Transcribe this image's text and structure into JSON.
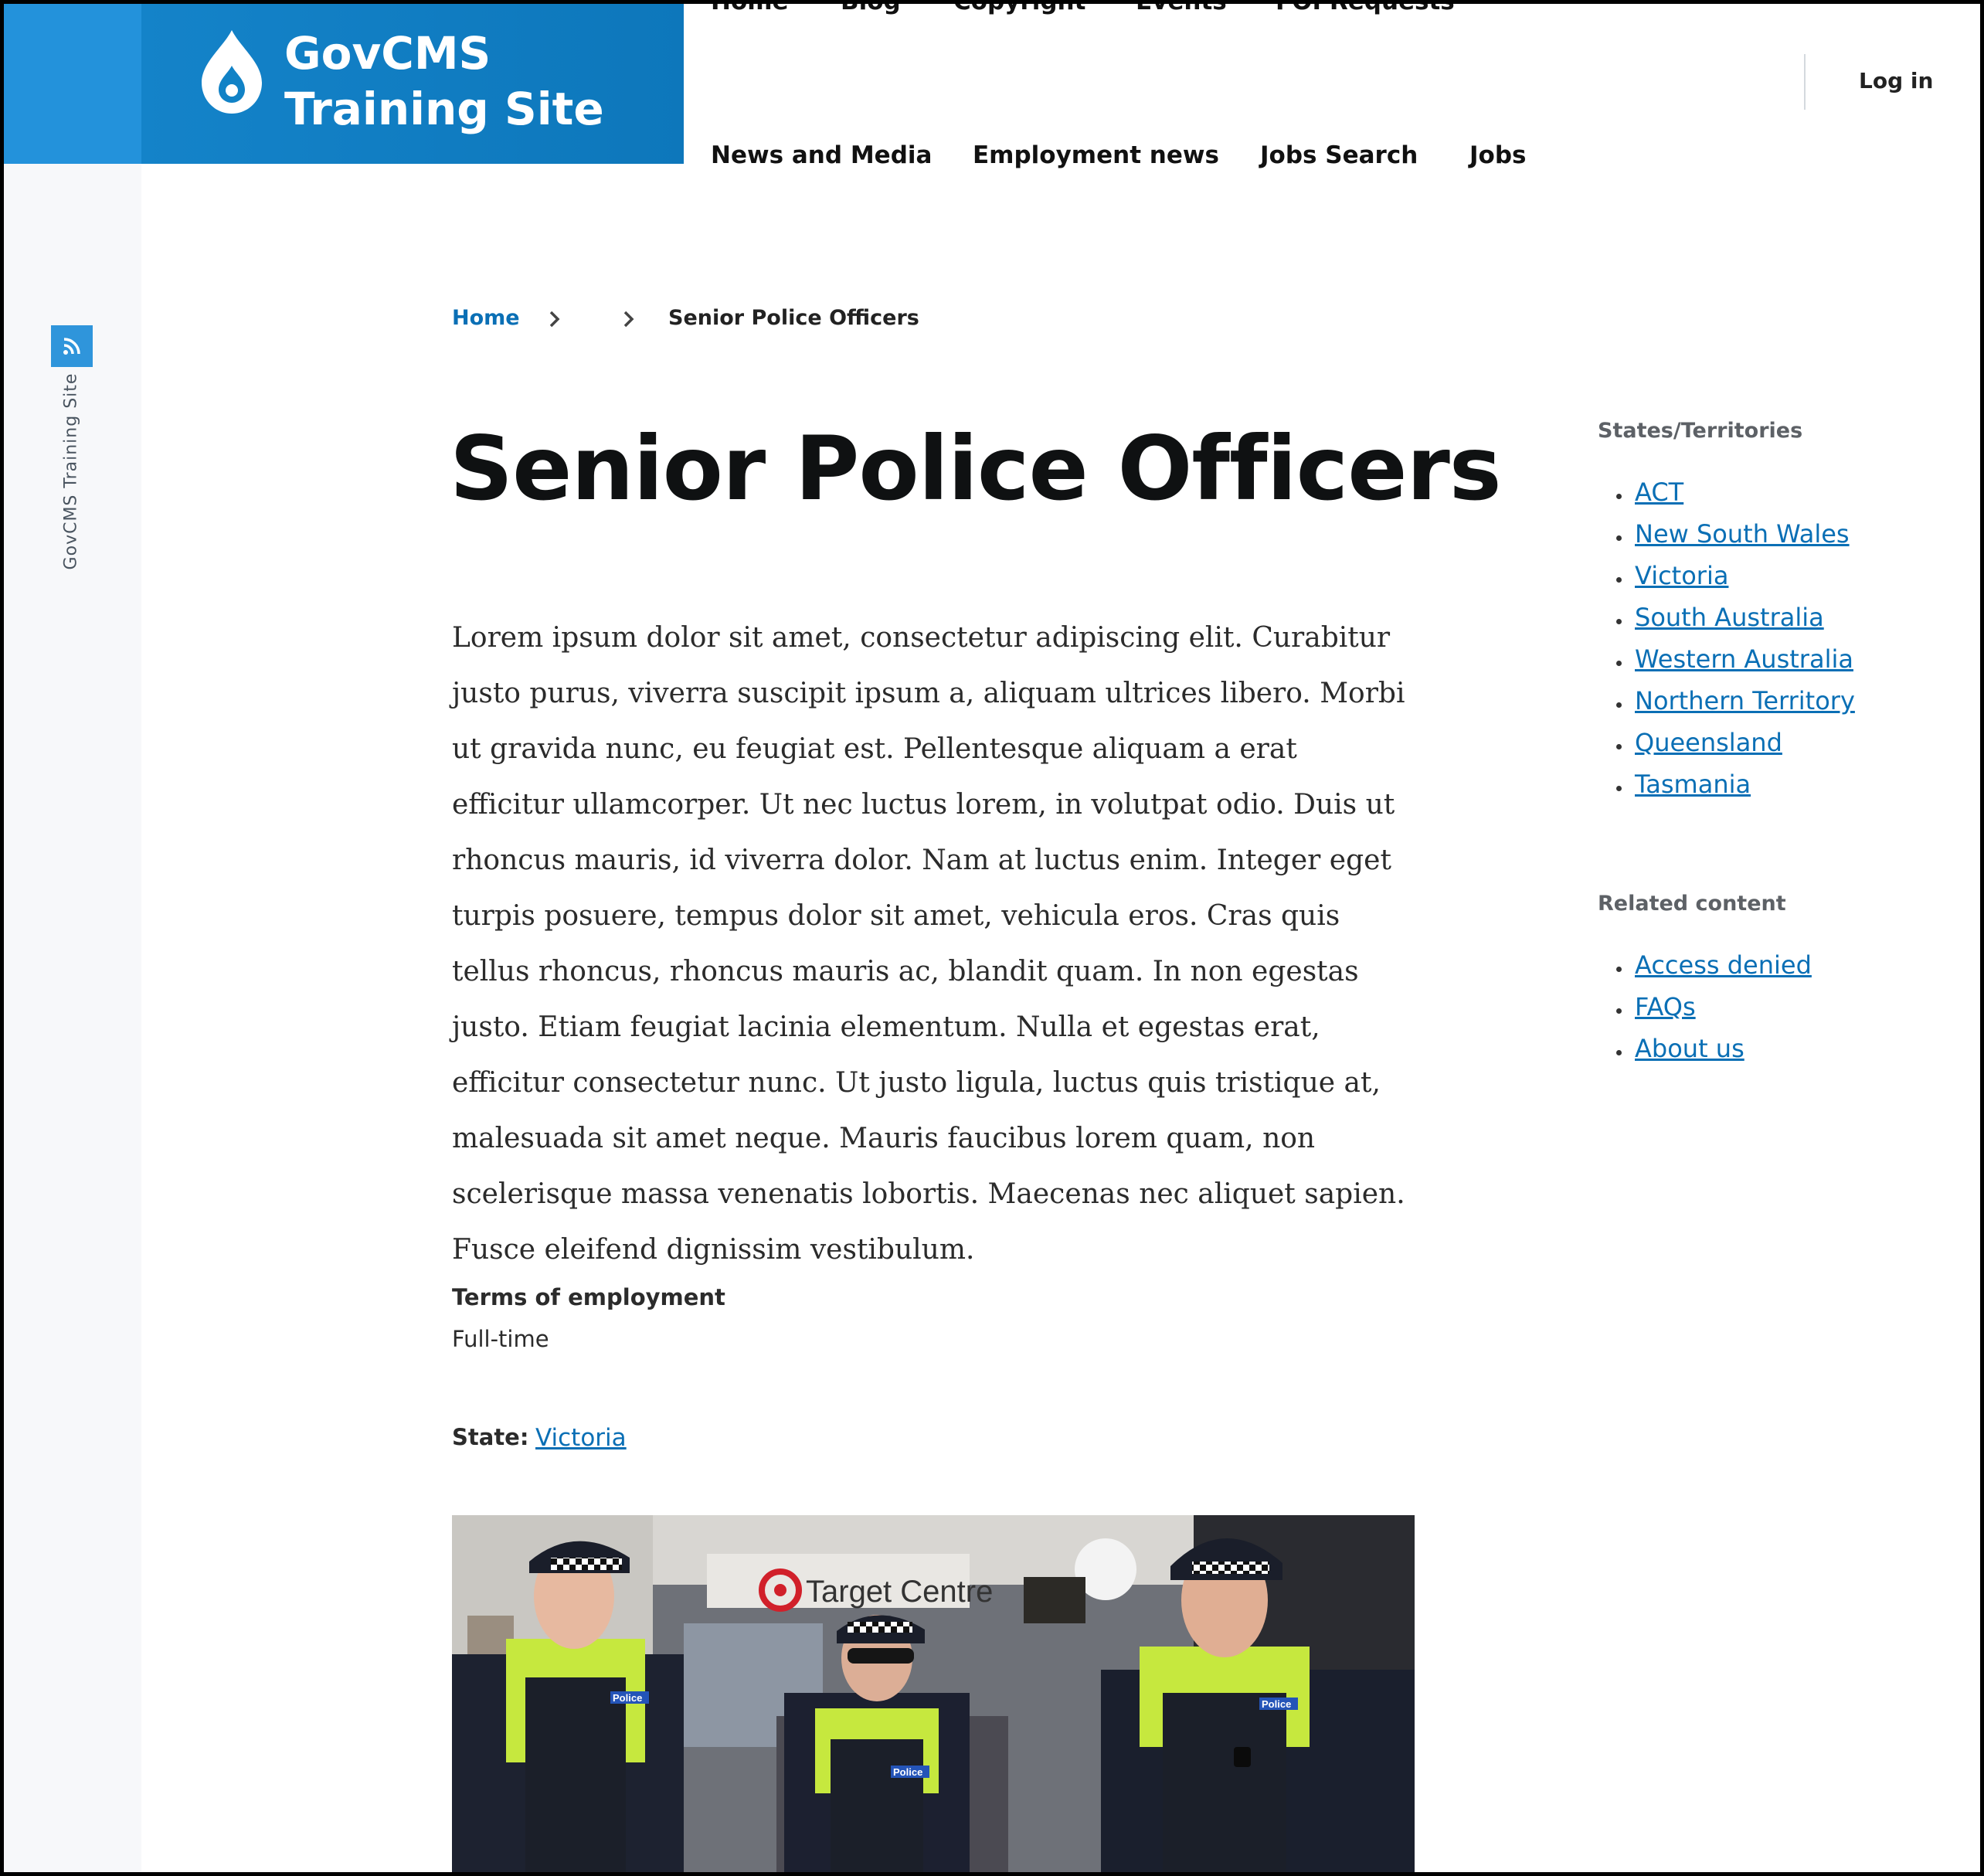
{
  "site": {
    "name_line1": "GovCMS",
    "name_line2": "Training Site",
    "rail_label": "GovCMS Training Site"
  },
  "nav": {
    "top": [
      "Home",
      "Blog",
      "Copyright",
      "Events",
      "FOI Requests"
    ],
    "bottom": [
      "News and Media",
      "Employment news",
      "Jobs Search",
      "Jobs"
    ],
    "login": "Log in"
  },
  "breadcrumb": {
    "home": "Home",
    "current": "Senior Police Officers"
  },
  "page": {
    "title": "Senior Police Officers",
    "body": "Lorem ipsum dolor sit amet, consectetur adipiscing elit. Curabitur justo purus, viverra suscipit ipsum a, aliquam ultrices libero. Morbi ut gravida nunc, eu feugiat est. Pellentesque aliquam a erat efficitur ullamcorper. Ut nec luctus lorem, in volutpat odio. Duis ut rhoncus mauris, id viverra dolor. Nam at luctus enim. Integer eget turpis posuere, tempus dolor sit amet, vehicula eros. Cras quis tellus rhoncus, rhoncus mauris ac, blandit quam. In non egestas justo. Etiam feugiat lacinia elementum. Nulla et egestas erat, efficitur consectetur nunc. Ut justo ligula, luctus quis tristique at, malesuada sit amet neque. Mauris faucibus lorem quam, non scelerisque massa venenatis lobortis. Maecenas nec aliquet sapien. Fusce eleifend dignissim vestibulum.",
    "terms_label": "Terms of employment",
    "terms_value": "Full-time",
    "state_label": "State:",
    "state_value": "Victoria"
  },
  "photo": {
    "sign_text": "Target Centre",
    "badge_text": "Police"
  },
  "sidebar": {
    "states_heading": "States/Territories",
    "states": [
      "ACT",
      "New South Wales",
      "Victoria",
      "South Australia",
      "Western Australia",
      "Northern Territory",
      "Queensland",
      "Tasmania"
    ],
    "related_heading": "Related content",
    "related": [
      "Access denied",
      "FAQs",
      "About us"
    ]
  },
  "colors": {
    "brand": "#0d77bb",
    "brand_light": "#2392db",
    "link": "#0a6fb5",
    "rail_bg": "#f7f8fa"
  }
}
